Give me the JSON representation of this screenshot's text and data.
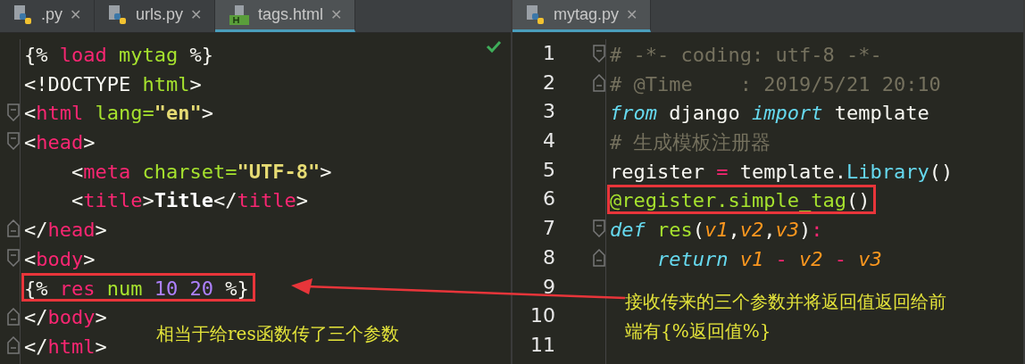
{
  "left_pane": {
    "tabs": [
      {
        "label": ".py",
        "kind": "python",
        "close": "✕",
        "selected": false
      },
      {
        "label": "urls.py",
        "kind": "python",
        "close": "✕",
        "selected": false
      },
      {
        "label": "tags.html",
        "kind": "html",
        "close": "✕",
        "selected": true
      }
    ],
    "lines": [
      {
        "kind": "plain",
        "boxed": false,
        "tokens": [
          {
            "text": "{% ",
            "kind": "plain"
          },
          {
            "text": "load ",
            "kind": "tag"
          },
          {
            "text": "mytag ",
            "kind": "attr"
          },
          {
            "text": "%}",
            "kind": "plain"
          }
        ]
      },
      {
        "kind": "plain",
        "boxed": false,
        "tokens": [
          {
            "text": "<!DOCTYPE ",
            "kind": "plain"
          },
          {
            "text": "html",
            "kind": "attr"
          },
          {
            "text": ">",
            "kind": "plain"
          }
        ]
      },
      {
        "kind": "fold_start",
        "boxed": false,
        "tokens": [
          {
            "text": "<",
            "kind": "plain"
          },
          {
            "text": "html ",
            "kind": "tag"
          },
          {
            "text": "lang=",
            "kind": "attr"
          },
          {
            "text": "\"en\"",
            "kind": "string"
          },
          {
            "text": ">",
            "kind": "plain"
          }
        ]
      },
      {
        "kind": "fold_start",
        "boxed": false,
        "tokens": [
          {
            "text": "<",
            "kind": "plain"
          },
          {
            "text": "head",
            "kind": "tag"
          },
          {
            "text": ">",
            "kind": "plain"
          }
        ]
      },
      {
        "kind": "plain",
        "boxed": false,
        "tokens": [
          {
            "text": "    <",
            "kind": "plain"
          },
          {
            "text": "meta ",
            "kind": "tag"
          },
          {
            "text": "charset=",
            "kind": "attr"
          },
          {
            "text": "\"UTF-8\"",
            "kind": "string"
          },
          {
            "text": ">",
            "kind": "plain"
          }
        ]
      },
      {
        "kind": "plain",
        "boxed": false,
        "tokens": [
          {
            "text": "    <",
            "kind": "plain"
          },
          {
            "text": "title",
            "kind": "tag"
          },
          {
            "text": ">",
            "kind": "plain"
          },
          {
            "text": "Title",
            "kind": "bold"
          },
          {
            "text": "</",
            "kind": "plain"
          },
          {
            "text": "title",
            "kind": "tag"
          },
          {
            "text": ">",
            "kind": "plain"
          }
        ]
      },
      {
        "kind": "fold_end",
        "boxed": false,
        "tokens": [
          {
            "text": "</",
            "kind": "plain"
          },
          {
            "text": "head",
            "kind": "tag"
          },
          {
            "text": ">",
            "kind": "plain"
          }
        ]
      },
      {
        "kind": "fold_start",
        "boxed": false,
        "tokens": [
          {
            "text": "<",
            "kind": "plain"
          },
          {
            "text": "body",
            "kind": "tag"
          },
          {
            "text": ">",
            "kind": "plain"
          }
        ]
      },
      {
        "kind": "plain",
        "boxed": true,
        "tokens": [
          {
            "text": "{% ",
            "kind": "plain"
          },
          {
            "text": "res ",
            "kind": "tag"
          },
          {
            "text": "num ",
            "kind": "attr"
          },
          {
            "text": "10 20 ",
            "kind": "number"
          },
          {
            "text": "%}",
            "kind": "plain"
          }
        ]
      },
      {
        "kind": "fold_end",
        "boxed": false,
        "tokens": [
          {
            "text": "</",
            "kind": "plain"
          },
          {
            "text": "body",
            "kind": "tag"
          },
          {
            "text": ">",
            "kind": "plain"
          }
        ]
      },
      {
        "kind": "fold_end",
        "boxed": false,
        "tokens": [
          {
            "text": "</",
            "kind": "plain"
          },
          {
            "text": "html",
            "kind": "tag"
          },
          {
            "text": ">",
            "kind": "plain"
          }
        ]
      }
    ],
    "note": "相当于给res函数传了三个参数"
  },
  "right_pane": {
    "tabs": [
      {
        "label": "mytag.py",
        "kind": "python",
        "close": "✕",
        "selected": true
      }
    ],
    "lines": [
      {
        "number": "1",
        "kind": "fold_start",
        "boxed": false,
        "tokens": [
          {
            "text": "# -*- coding: utf-8 -*-",
            "kind": "comment"
          }
        ]
      },
      {
        "number": "2",
        "kind": "fold_end",
        "boxed": false,
        "tokens": [
          {
            "text": "# @Time    : 2019/5/21 20:10",
            "kind": "comment"
          }
        ]
      },
      {
        "number": "3",
        "kind": "plain",
        "boxed": false,
        "tokens": [
          {
            "text": "from",
            "kind": "keyword"
          },
          {
            "text": " django ",
            "kind": "plain"
          },
          {
            "text": "import",
            "kind": "keyword"
          },
          {
            "text": " template",
            "kind": "plain"
          }
        ]
      },
      {
        "number": "4",
        "kind": "plain",
        "boxed": false,
        "tokens": [
          {
            "text": "# 生成模板注册器",
            "kind": "comment"
          }
        ]
      },
      {
        "number": "5",
        "kind": "plain",
        "boxed": false,
        "tokens": [
          {
            "text": "register ",
            "kind": "plain"
          },
          {
            "text": "=",
            "kind": "tag"
          },
          {
            "text": " template.",
            "kind": "plain"
          },
          {
            "text": "Library",
            "kind": "builtin"
          },
          {
            "text": "()",
            "kind": "plain"
          }
        ]
      },
      {
        "number": "6",
        "kind": "plain",
        "boxed": true,
        "tokens": [
          {
            "text": "@register.simple_tag",
            "kind": "attr"
          },
          {
            "text": "()",
            "kind": "plain"
          }
        ]
      },
      {
        "number": "7",
        "kind": "fold_start",
        "boxed": false,
        "tokens": [
          {
            "text": "def",
            "kind": "keyword"
          },
          {
            "text": " res",
            "kind": "attr"
          },
          {
            "text": "(",
            "kind": "plain"
          },
          {
            "text": "v1",
            "kind": "param"
          },
          {
            "text": ",",
            "kind": "plain"
          },
          {
            "text": "v2",
            "kind": "param"
          },
          {
            "text": ",",
            "kind": "plain"
          },
          {
            "text": "v3",
            "kind": "param"
          },
          {
            "text": ")",
            "kind": "plain"
          },
          {
            "text": ":",
            "kind": "tag"
          }
        ]
      },
      {
        "number": "8",
        "kind": "fold_end",
        "boxed": false,
        "tokens": [
          {
            "text": "    return",
            "kind": "keyword"
          },
          {
            "text": " v1 ",
            "kind": "param"
          },
          {
            "text": "-",
            "kind": "tag"
          },
          {
            "text": " v2 ",
            "kind": "param"
          },
          {
            "text": "-",
            "kind": "tag"
          },
          {
            "text": " v3",
            "kind": "param"
          }
        ]
      },
      {
        "number": "9",
        "kind": "plain"
      },
      {
        "number": "10",
        "kind": "plain"
      },
      {
        "number": "11",
        "kind": "plain"
      }
    ],
    "note": "接收传来的三个参数并将返回值返回给前端有{%返回值%}"
  }
}
